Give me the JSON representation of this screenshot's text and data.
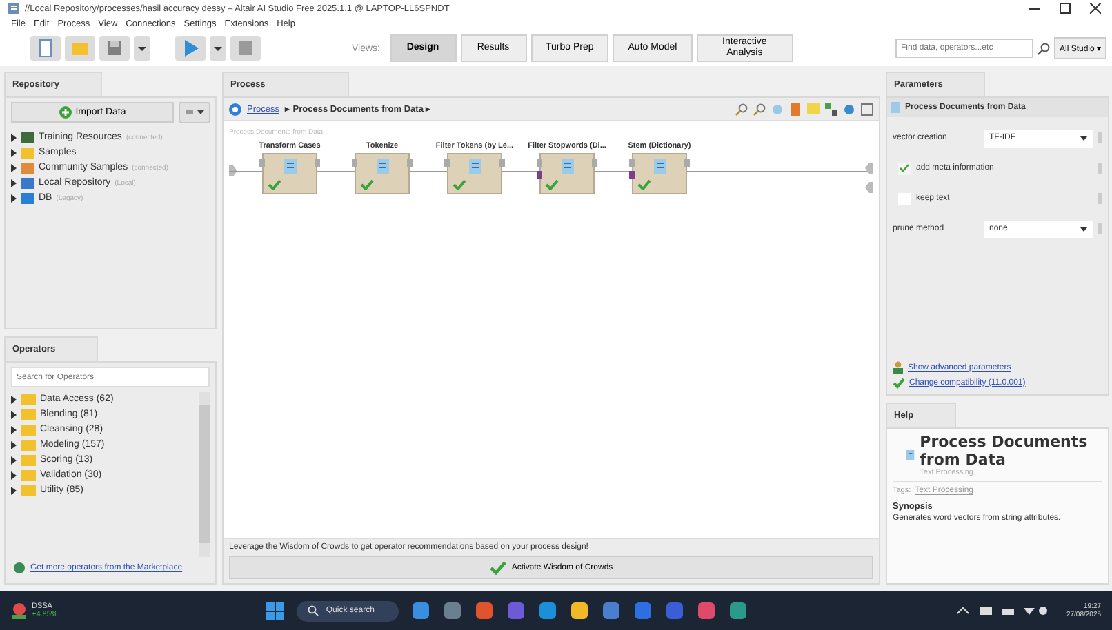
{
  "window": {
    "title": "//Local Repository/processes/hasil accuracy dessy – Altair AI Studio Free 2025.1.1 @ LAPTOP-LL6SPNDT"
  },
  "menu": [
    "File",
    "Edit",
    "Process",
    "View",
    "Connections",
    "Settings",
    "Extensions",
    "Help"
  ],
  "views": {
    "label": "Views:",
    "tabs": [
      {
        "label": "Design",
        "selected": true
      },
      {
        "label": "Results",
        "selected": false
      },
      {
        "label": "Turbo Prep",
        "selected": false
      },
      {
        "label": "Auto Model",
        "selected": false
      },
      {
        "label": "Interactive Analysis",
        "selected": false
      }
    ]
  },
  "global_search": {
    "placeholder": "Find data, operators...etc",
    "scope": "All Studio ▾"
  },
  "repository": {
    "title": "Repository",
    "import_button": "Import Data",
    "items": [
      {
        "name": "Training Resources",
        "note": "(connected)",
        "color": "#3d6b3a"
      },
      {
        "name": "Samples",
        "color": "#f2c12e"
      },
      {
        "name": "Community Samples",
        "note": "(connected)",
        "color": "#e08a3c"
      },
      {
        "name": "Local Repository",
        "note": "(Local)",
        "color": "#3a78c8"
      },
      {
        "name": "DB",
        "note": "(Legacy)",
        "color": "#2a7fd4"
      }
    ]
  },
  "operators": {
    "title": "Operators",
    "placeholder": "Search for Operators",
    "items": [
      "Data Access (62)",
      "Blending (81)",
      "Cleansing (28)",
      "Modeling (157)",
      "Scoring (13)",
      "Validation (30)",
      "Utility (85)"
    ],
    "marketplace_link": "Get more operators from the Marketplace"
  },
  "process": {
    "title": "Process",
    "breadcrumb_root": "Process",
    "breadcrumb_rest": "▸ Process Documents from Data ▸",
    "canvas_title": "Process Documents from Data",
    "steps": [
      {
        "name": "Transform Cases",
        "extra_input": false,
        "ok": true
      },
      {
        "name": "Tokenize",
        "extra_input": false,
        "ok": true
      },
      {
        "name": "Filter Tokens (by Le...",
        "extra_input": false,
        "ok": true
      },
      {
        "name": "Filter Stopwords (Di...",
        "extra_input": true,
        "ok": true
      },
      {
        "name": "Stem (Dictionary)",
        "extra_input": true,
        "ok": true
      }
    ],
    "wisdom_text": "Leverage the Wisdom of Crowds to get operator recommendations based on your process design!",
    "wisdom_button": "Activate Wisdom of Crowds"
  },
  "parameters": {
    "title": "Parameters",
    "operator": "Process Documents from Data",
    "items": [
      {
        "kind": "select",
        "label": "vector creation",
        "value": "TF-IDF"
      },
      {
        "kind": "checkbox",
        "label": "add meta information",
        "checked": true
      },
      {
        "kind": "checkbox",
        "label": "keep text",
        "checked": false
      },
      {
        "kind": "select",
        "label": "prune method",
        "value": "none"
      }
    ],
    "advanced_link": "Show advanced parameters",
    "compat_link": "Change compatibility (11.0.001)"
  },
  "help": {
    "title": "Help",
    "heading": "Process Documents from Data",
    "category": "Text Processing",
    "tags_label": "Tags:",
    "tag": "Text Processing",
    "synopsis_title": "Synopsis",
    "synopsis": "Generates word vectors from string attributes."
  },
  "taskbar": {
    "stock_name": "DSSA",
    "stock_change": "+4.85%",
    "search": "Quick search",
    "time": "19:27",
    "date": "27/08/2025"
  }
}
